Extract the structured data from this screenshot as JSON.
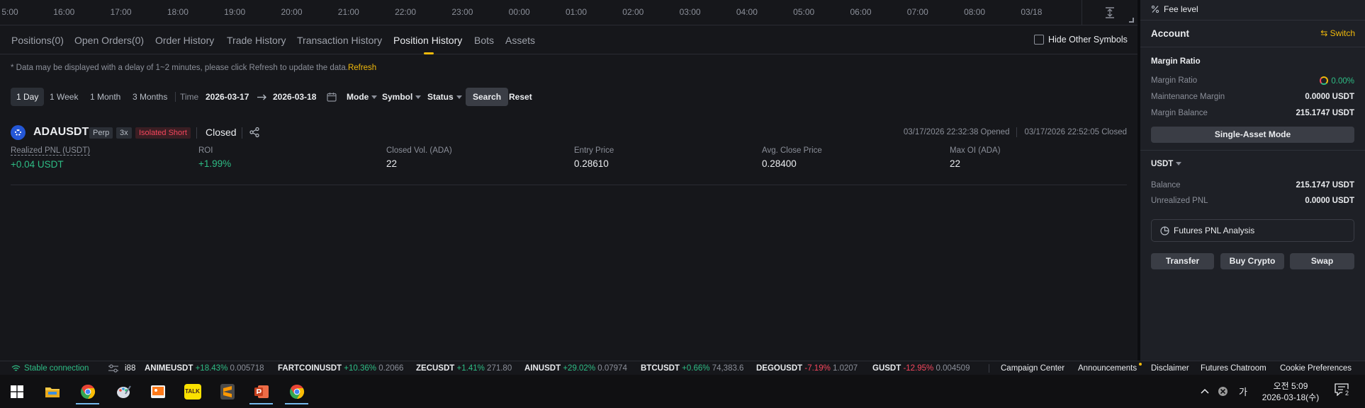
{
  "axis": {
    "labels": [
      "5:00",
      "16:00",
      "17:00",
      "18:00",
      "19:00",
      "20:00",
      "21:00",
      "22:00",
      "23:00",
      "00:00",
      "01:00",
      "02:00",
      "03:00",
      "04:00",
      "05:00",
      "06:00",
      "07:00",
      "08:00",
      "03/18"
    ]
  },
  "tabs": [
    {
      "label": "Positions(0)",
      "active": false
    },
    {
      "label": "Open Orders(0)",
      "active": false
    },
    {
      "label": "Order History",
      "active": false
    },
    {
      "label": "Trade History",
      "active": false
    },
    {
      "label": "Transaction History",
      "active": false
    },
    {
      "label": "Position History",
      "active": true
    },
    {
      "label": "Bots",
      "active": false
    },
    {
      "label": "Assets",
      "active": false
    }
  ],
  "hide_other_symbols": {
    "label": "Hide Other Symbols",
    "checked": false
  },
  "notice": {
    "text": "* Data may be displayed with a delay of 1~2 minutes, please click Refresh to update the data.",
    "refresh_label": "Refresh"
  },
  "filters": {
    "ranges": [
      "1 Day",
      "1 Week",
      "1 Month",
      "3 Months"
    ],
    "selected_range": "1 Day",
    "time_label": "Time",
    "date_from": "2026-03-17",
    "date_to": "2026-03-18",
    "mode_label": "Mode",
    "symbol_label": "Symbol",
    "status_label": "Status",
    "search_label": "Search",
    "reset_label": "Reset"
  },
  "position": {
    "pair": "ADAUSDT",
    "type_badge": "Perp",
    "leverage_badge": "3x",
    "margin_badge": "Isolated Short",
    "status": "Closed",
    "opened": "03/17/2026 22:32:38 Opened",
    "closed": "03/17/2026 22:52:05 Closed",
    "metrics": [
      {
        "label": "Realized PNL (USDT)",
        "value": "+0.04 USDT",
        "tone": "green",
        "underline": true
      },
      {
        "label": "ROI",
        "value": "+1.99%",
        "tone": "green",
        "underline": false
      },
      {
        "label": "Closed Vol. (ADA)",
        "value": "22",
        "tone": "normal",
        "underline": false
      },
      {
        "label": "Entry Price",
        "value": "0.28610",
        "tone": "normal",
        "underline": false
      },
      {
        "label": "Avg. Close Price",
        "value": "0.28400",
        "tone": "normal",
        "underline": false
      },
      {
        "label": "Max OI (ADA)",
        "value": "22",
        "tone": "normal",
        "underline": false
      }
    ]
  },
  "account": {
    "fee_level": "Fee level",
    "title": "Account",
    "switch_label": "Switch",
    "margin_section": "Margin Ratio",
    "margin_ratio_label": "Margin Ratio",
    "margin_ratio_value": "0.00%",
    "maintenance_margin_label": "Maintenance Margin",
    "maintenance_margin_value": "0.0000 USDT",
    "margin_balance_label": "Margin Balance",
    "margin_balance_value": "215.1747 USDT",
    "single_asset_mode": "Single-Asset Mode",
    "currency": "USDT",
    "balance_label": "Balance",
    "balance_value": "215.1747 USDT",
    "unrealized_pnl_label": "Unrealized PNL",
    "unrealized_pnl_value": "0.0000 USDT",
    "pnl_analysis": "Futures PNL Analysis",
    "transfer": "Transfer",
    "buy_crypto": "Buy Crypto",
    "swap": "Swap"
  },
  "statusbar": {
    "connection": "Stable connection",
    "ticker_lead": "i88",
    "tickers": [
      {
        "symbol": "ANIMEUSDT",
        "change": "+18.43%",
        "price": "0.005718",
        "dir": "up"
      },
      {
        "symbol": "FARTCOINUSDT",
        "change": "+10.36%",
        "price": "0.2066",
        "dir": "up"
      },
      {
        "symbol": "ZECUSDT",
        "change": "+1.41%",
        "price": "271.80",
        "dir": "up"
      },
      {
        "symbol": "AINUSDT",
        "change": "+29.02%",
        "price": "0.07974",
        "dir": "up"
      },
      {
        "symbol": "BTCUSDT",
        "change": "+0.66%",
        "price": "74,383.6",
        "dir": "up"
      },
      {
        "symbol": "DEGOUSDT",
        "change": "-7.19%",
        "price": "1.0207",
        "dir": "down"
      },
      {
        "symbol": "GUSDT",
        "change": "-12.95%",
        "price": "0.004509",
        "dir": "down"
      }
    ],
    "links": [
      "Campaign Center",
      "Announcements",
      "Disclaimer",
      "Futures Chatroom",
      "Cookie Preferences"
    ]
  },
  "taskbar": {
    "apps": [
      "windows-start",
      "file-explorer",
      "chrome",
      "paint",
      "photos",
      "kakaotalk",
      "sublime-text",
      "powerpoint",
      "chrome"
    ],
    "kakao_label": "TALK",
    "ime": "가",
    "time": "오전 5:09",
    "date": "2026-03-18(수)",
    "notification_count": "2"
  },
  "colors": {
    "accent": "#f0b90b",
    "up": "#2ebd85",
    "down": "#f6465d",
    "bg": "#16171b",
    "panel": "#1e2026"
  }
}
